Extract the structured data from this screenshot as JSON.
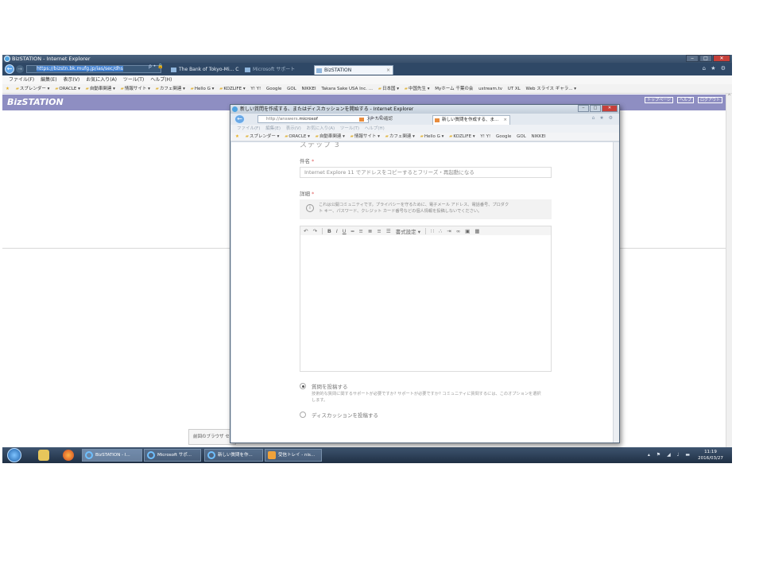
{
  "main_window": {
    "title": "BizSTATION - Internet Explorer",
    "url": "https://bizstn.bk.mufg.jp/ias/sec/dhs",
    "search_controls": "ρ • 🔒",
    "tabs": [
      {
        "label": "The Bank of Tokyo-Mi... C"
      },
      {
        "label": "Microsoft サポート"
      },
      {
        "label": "BizSTATION"
      }
    ],
    "menu": [
      "ファイル(F)",
      "編集(E)",
      "表示(V)",
      "お気に入り(A)",
      "ツール(T)",
      "ヘルプ(H)"
    ],
    "favorites": [
      "スプレンダー ▾",
      "ORACLE ▾",
      "自動車関連 ▾",
      "情報サイト ▾",
      "カフェ関連 ▾",
      "Hello G ▾",
      "KOZLIFE ▾",
      "Y! Y!",
      "Google",
      "GOL",
      "NIKKEI",
      "Takara Sake USA Inc. ...",
      "日本国 ▾",
      "中国先生 ▾",
      "Myホーム 千葉の会",
      "ustream.tv",
      "UT XL",
      "Web スライス ギャラ... ▾"
    ],
    "biz_logo": "BizSTATION",
    "biz_links": [
      "トップページ",
      "ヘルプ",
      "ログアウト"
    ],
    "prev_browser_text": "前回のブラウザ セ"
  },
  "popup_window": {
    "title": "新しい質問を作成する、またはディスカッションを開始する - Internet Explorer",
    "url_prefix": "http://answers.",
    "url_domain": "microsof",
    "url_controls": "ρ • C",
    "tabs": [
      {
        "label": "メールの確認"
      },
      {
        "label": "新しい質問を作成する、ま..."
      }
    ],
    "menu": [
      "ファイル(F)",
      "編集(E)",
      "表示(V)",
      "お気に入り(A)",
      "ツール(T)",
      "ヘルプ(H)"
    ],
    "favorites": [
      "スプレンダー ▾",
      "ORACLE ▾",
      "自動車関連 ▾",
      "情報サイト ▾",
      "カフェ関連 ▾",
      "Hello G ▾",
      "KOZLIFE ▾",
      "Y! Y!",
      "Google",
      "GOL",
      "NIKKEI"
    ],
    "form": {
      "heading": "ステップ 3",
      "subject_label": "件名",
      "subject_value": "Internet Explore 11 でアドレスをコピーするとフリーズ・再起動になる",
      "details_label": "詳細",
      "notice_line1": "これは公開コミュニティです。プライバシーを守るために、電子メール アドレス、電話番号、プロダク",
      "notice_line2": "ト キー、パスワード、クレジット カード番号などの個人情報を投稿しないでください。",
      "format_label": "書式設定 ▾",
      "toolbar": {
        "undo": "↶",
        "redo": "↷",
        "bold": "B",
        "italic": "I",
        "underline": "U",
        "strikethrough": "═",
        "align_left": "≡",
        "align_center": "≣",
        "align_right": "≡",
        "justify": "☰",
        "bullets": "∷",
        "numbered": "∴",
        "indent": "⇥",
        "link": "∞",
        "image": "▣",
        "table": "▦"
      },
      "option_question_title": "質問を投稿する",
      "option_question_desc": "技術的な質問に関するサポートが必要ですか? サポートが必要ですか? コミュニティに質問するには、このオプションを選択します。",
      "option_discussion_title": "ディスカッションを投稿する"
    }
  },
  "taskbar": {
    "tasks": [
      {
        "label": "BizSTATION - I..."
      },
      {
        "label": "Microsoft サポ..."
      },
      {
        "label": "新しい質問を作..."
      },
      {
        "label": "受信トレイ - nis..."
      }
    ],
    "tray_icons": "▴ ⚑ ◢ ♩ ▬",
    "time": "11:19",
    "date": "2016/03/27"
  }
}
